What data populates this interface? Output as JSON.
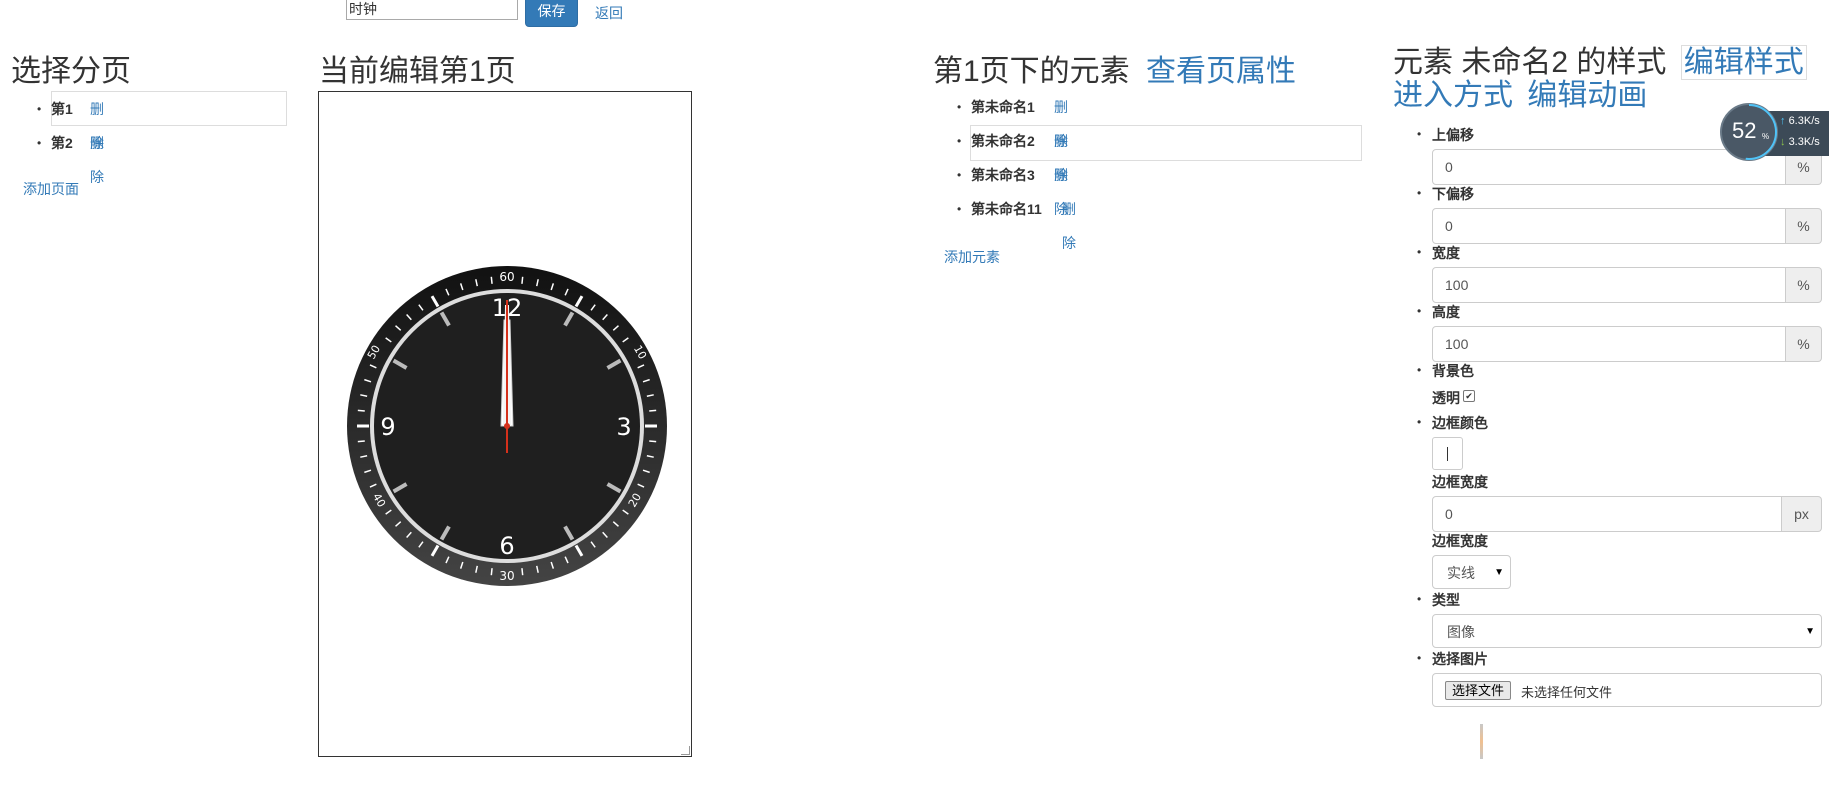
{
  "toolbar": {
    "name_value": "时钟",
    "save_label": "保存",
    "back_label": "返回"
  },
  "left": {
    "heading": "选择分页",
    "pages": [
      {
        "name": "第1",
        "delete": "删除"
      },
      {
        "name": "第2",
        "delete": "删除"
      }
    ],
    "add_page": "添加页面"
  },
  "center": {
    "heading": "当前编辑第1页",
    "clock": {
      "hour_labels": [
        "12",
        "3",
        "6",
        "9"
      ],
      "minute_labels": [
        "60",
        "10",
        "20",
        "30",
        "40",
        "50"
      ],
      "time": "12:00"
    }
  },
  "elements": {
    "heading": "第1页下的元素",
    "view_page_props": "查看页属性",
    "items": [
      {
        "name": "第未命名1",
        "delete": "删除"
      },
      {
        "name": "第未命名2",
        "delete": "删除"
      },
      {
        "name": "第未命名3",
        "delete": "删除"
      },
      {
        "name": "第未命名11",
        "delete": "删除"
      }
    ],
    "add_element": "添加元素"
  },
  "style_panel": {
    "heading": "元素 未命名2 的样式",
    "edit_style": "编辑样式",
    "entry_mode": "进入方式",
    "edit_animation": "编辑动画",
    "top_offset_label": "上偏移",
    "top_offset_value": "0",
    "bottom_offset_label": "下偏移",
    "bottom_offset_value": "0",
    "width_label": "宽度",
    "width_value": "100",
    "height_label": "高度",
    "height_value": "100",
    "percent_unit": "%",
    "bg_color_label": "背景色",
    "transparent_label": "透明",
    "border_color_label": "边框颜色",
    "border_width_label": "边框宽度",
    "border_width_value": "0",
    "px_unit": "px",
    "border_style_label": "边框宽度",
    "border_style_value": "实线",
    "type_label": "类型",
    "type_value": "图像",
    "choose_image_label": "选择图片",
    "choose_file_button": "选择文件",
    "no_file_text": "未选择任何文件"
  },
  "net_widget": {
    "percent": "52",
    "percent_unit": "%",
    "upload": "6.3K/s",
    "download": "3.3K/s"
  }
}
